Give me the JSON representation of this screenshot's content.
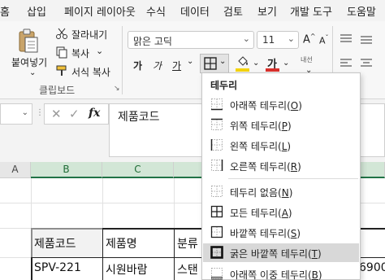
{
  "ribbon_tabs": [
    "홈",
    "삽입",
    "페이지 레이아웃",
    "수식",
    "데이터",
    "검토",
    "보기",
    "개발 도구",
    "도움말"
  ],
  "clipboard": {
    "paste_label": "붙여넣기",
    "cut_label": "잘라내기",
    "copy_label": "복사",
    "format_painter_label": "서식 복사",
    "group_label": "클립보드"
  },
  "font": {
    "font_name": "맑은 고딕",
    "font_size": "11",
    "bold_glyph": "가",
    "italic_glyph": "가",
    "underline_glyph": "가",
    "fill_glyph": "가",
    "font_color_glyph": "가",
    "phonetic_label": "내선"
  },
  "formula_bar": {
    "fx": "fx",
    "content": "제품코드"
  },
  "sheet": {
    "columns": [
      "A",
      "B",
      "C"
    ],
    "rows": [
      [
        "제품코드",
        "제품명",
        "분류"
      ],
      [
        "SPV-221",
        "시원바람",
        "스탠"
      ]
    ],
    "partial_value": "6900"
  },
  "border_menu": {
    "title": "테두리",
    "items": [
      {
        "label": "아래쪽 테두리",
        "key": "O",
        "icon": "border-bottom-icon"
      },
      {
        "label": "위쪽 테두리",
        "key": "P",
        "icon": "border-top-icon"
      },
      {
        "label": "왼쪽 테두리",
        "key": "L",
        "icon": "border-left-icon"
      },
      {
        "label": "오른쪽 테두리",
        "key": "R",
        "icon": "border-right-icon"
      },
      {
        "label": "테두리 없음",
        "key": "N",
        "icon": "border-none-icon"
      },
      {
        "label": "모든 테두리",
        "key": "A",
        "icon": "border-all-icon"
      },
      {
        "label": "바깥쪽 테두리",
        "key": "S",
        "icon": "border-outside-icon"
      },
      {
        "label": "굵은 바깥쪽 테두리",
        "key": "T",
        "icon": "border-thick-outside-icon"
      },
      {
        "label": "아래쪽 이중 테두리",
        "key": "B",
        "icon": "border-double-bottom-icon"
      }
    ]
  },
  "colors": {
    "accent_green": "#217346",
    "fill_yellow": "#f4d40e",
    "font_red": "#d9302c",
    "highlight": "#d8d8d8"
  }
}
